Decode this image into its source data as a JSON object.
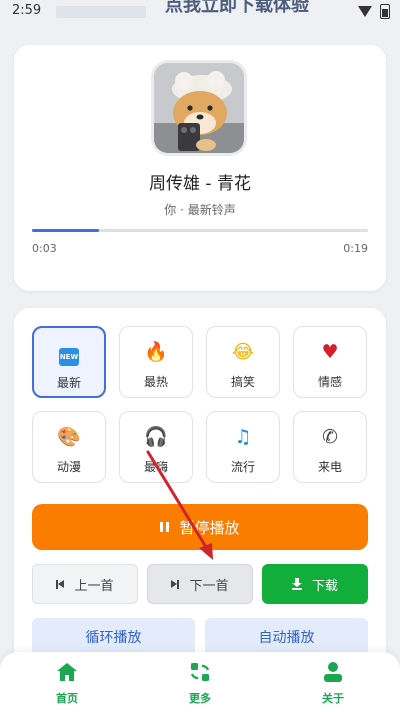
{
  "status_bar": {
    "time": "2:59",
    "banner": "点我立即下载体验"
  },
  "player": {
    "cover_icon": "shiba-dog-cover-image",
    "title": "周传雄 - 青花",
    "subtitle": "你 · 最新铃声",
    "progress_fraction": 0.2,
    "current_time": "0:03",
    "total_time": "0:19",
    "accent_color": "#3e6fdc"
  },
  "categories": [
    {
      "label": "最新",
      "icon": "new-icon",
      "active": true
    },
    {
      "label": "最热",
      "icon": "fire-icon",
      "active": false
    },
    {
      "label": "搞笑",
      "icon": "laugh-icon",
      "active": false
    },
    {
      "label": "情感",
      "icon": "heart-icon",
      "active": false
    },
    {
      "label": "动漫",
      "icon": "palette-icon",
      "active": false
    },
    {
      "label": "最嗨",
      "icon": "headphones-icon",
      "active": false
    },
    {
      "label": "流行",
      "icon": "music-note-icon",
      "active": false
    },
    {
      "label": "来电",
      "icon": "phone-icon",
      "active": false
    }
  ],
  "controls": {
    "pause_label": "暂停播放",
    "prev_label": "上一首",
    "next_label": "下一首",
    "download_label": "下载",
    "loop_label": "循环播放",
    "auto_label": "自动播放",
    "pause_color": "#fa7d00",
    "download_color": "#12ae3c"
  },
  "bottom_nav": {
    "home_label": "首页",
    "more_label": "更多",
    "about_label": "关于",
    "active_color": "#1aa652"
  }
}
